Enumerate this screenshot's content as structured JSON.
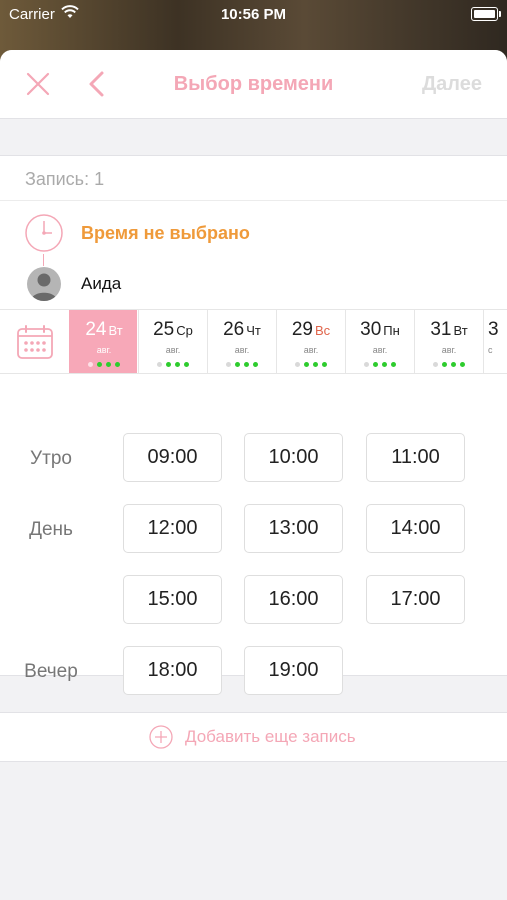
{
  "statusbar": {
    "carrier": "Carrier",
    "time": "10:56 PM"
  },
  "nav": {
    "title": "Выбор времени",
    "next_label": "Далее"
  },
  "entry": {
    "label": "Запись: 1"
  },
  "time_status": "Время не выбрано",
  "master": {
    "name": "Аида"
  },
  "days": [
    {
      "num": "24",
      "wd": "Вт",
      "month": "авг."
    },
    {
      "num": "25",
      "wd": "Ср",
      "month": "авг."
    },
    {
      "num": "26",
      "wd": "Чт",
      "month": "авг."
    },
    {
      "num": "29",
      "wd": "Вс",
      "month": "авг."
    },
    {
      "num": "30",
      "wd": "Пн",
      "month": "авг."
    },
    {
      "num": "31",
      "wd": "Вт",
      "month": "авг."
    },
    {
      "num": "3",
      "wd": "",
      "month": "с"
    }
  ],
  "periods": {
    "morning": "Утро",
    "day": "День",
    "evening": "Вечер"
  },
  "slots": [
    "09:00",
    "10:00",
    "11:00",
    "12:00",
    "13:00",
    "14:00",
    "15:00",
    "16:00",
    "17:00",
    "18:00",
    "19:00"
  ],
  "add_label": "Добавить еще запись",
  "colors": {
    "accent": "#f4a7b6",
    "warning": "#ef9a3a",
    "available": "#2ecc2e",
    "weekend": "#e0654b"
  }
}
